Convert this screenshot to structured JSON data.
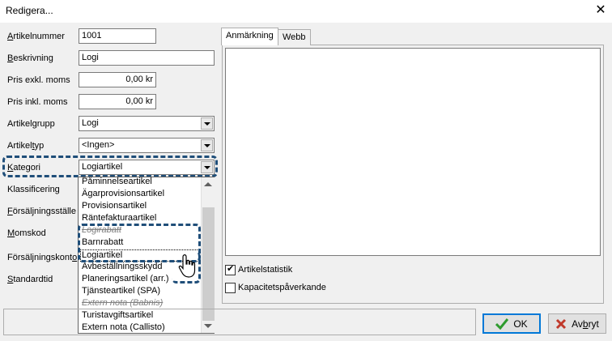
{
  "window": {
    "title": "Redigera...",
    "close_glyph": "✕"
  },
  "form": {
    "artikelnummer": {
      "label_u": "A",
      "label_rest": "rtikelnummer",
      "value": "1001"
    },
    "beskrivning": {
      "label_u": "B",
      "label_rest": "eskrivning",
      "value": "Logi"
    },
    "pris_exkl": {
      "label": "Pris exkl. moms",
      "value": "0,00 kr"
    },
    "pris_inkl": {
      "label": "Pris inkl. moms",
      "value": "0,00 kr"
    },
    "artikelgrupp": {
      "label_pre": "Artikel",
      "label_u": "g",
      "label_rest": "rupp",
      "value": "Logi"
    },
    "artikeltyp": {
      "label_pre": "Artikel",
      "label_u": "t",
      "label_rest": "yp",
      "value": "<Ingen>"
    },
    "kategori": {
      "label_u": "K",
      "label_rest": "ategori",
      "value": "Logiartikel"
    },
    "klassificering": {
      "label": "Klassificering"
    },
    "forsaljningsstalle": {
      "label_u": "F",
      "label_rest": "örsäljningsställe"
    },
    "momskod": {
      "label_u": "M",
      "label_rest": "omskod"
    },
    "forsaljningskonto": {
      "label_pre": "Försäljningskont",
      "label_u": "o",
      "label_rest": ""
    },
    "standardtid": {
      "label_u": "S",
      "label_rest": "tandardtid"
    }
  },
  "dropdown": {
    "items": [
      {
        "text": "Påminnelseartikel",
        "style": "normal"
      },
      {
        "text": "Ägarprovisionsartikel",
        "style": "normal"
      },
      {
        "text": "Provisionsartikel",
        "style": "normal"
      },
      {
        "text": "Räntefakturaartikel",
        "style": "normal"
      },
      {
        "text": "Logirabatt",
        "style": "strike"
      },
      {
        "text": "Barnrabatt",
        "style": "normal"
      },
      {
        "text": "Logiartikel",
        "style": "selected"
      },
      {
        "text": "Avbeställningsskydd",
        "style": "normal"
      },
      {
        "text": "Planeringsartikel (arr.)",
        "style": "normal"
      },
      {
        "text": "Tjänsteartikel (SPA)",
        "style": "normal"
      },
      {
        "text": "Extern nota (Babnis)",
        "style": "strike"
      },
      {
        "text": "Turistavgiftsartikel",
        "style": "normal"
      },
      {
        "text": "Extern nota (Callisto)",
        "style": "normal"
      }
    ]
  },
  "tabs": [
    {
      "label": "Anmärkning",
      "active": true
    },
    {
      "label": "Webb",
      "active": false
    }
  ],
  "checkboxes": {
    "artikelstatistik": {
      "label": "Artikelstatistik",
      "checked": true
    },
    "kapacitet": {
      "label": "Kapacitetspåverkande",
      "checked": false
    }
  },
  "buttons": {
    "ok": {
      "label": "OK"
    },
    "cancel": {
      "label_pre": "Av",
      "label_u": "b",
      "label_rest": "ryt"
    }
  },
  "colors": {
    "highlight": "#1f4e79",
    "ok_icon": "#2e9b2e",
    "cancel_icon": "#c0392b"
  }
}
